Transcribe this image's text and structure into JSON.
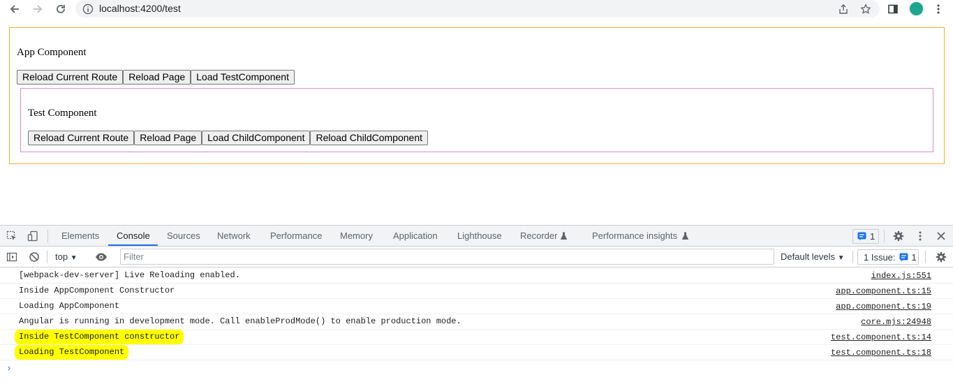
{
  "browser": {
    "url": "localhost:4200/test"
  },
  "app": {
    "heading": "App Component",
    "buttons": [
      "Reload Current Route",
      "Reload Page",
      "Load TestComponent"
    ]
  },
  "test": {
    "heading": "Test Component",
    "buttons": [
      "Reload Current Route",
      "Reload Page",
      "Load ChildComponent",
      "Reload ChildComponent"
    ]
  },
  "devtools": {
    "tabs": [
      "Elements",
      "Console",
      "Sources",
      "Network",
      "Performance",
      "Memory",
      "Application",
      "Lighthouse",
      "Recorder",
      "Performance insights"
    ],
    "active_tab": "Console",
    "issue_count": "1",
    "context": "top",
    "filter_placeholder": "Filter",
    "levels_label": "Default levels",
    "issues_label": "1 Issue:",
    "issues_count": "1"
  },
  "console": {
    "logs": [
      {
        "message": "[webpack-dev-server] Live Reloading enabled.",
        "source": "index.js:551",
        "highlighted": false
      },
      {
        "message": "Inside AppComponent Constructor",
        "source": "app.component.ts:15",
        "highlighted": false
      },
      {
        "message": "Loading AppComponent",
        "source": "app.component.ts:19",
        "highlighted": false
      },
      {
        "message": "Angular is running in development mode. Call enableProdMode() to enable production mode.",
        "source": "core.mjs:24948",
        "highlighted": false
      },
      {
        "message": "Inside TestComponent constructor",
        "source": "test.component.ts:14",
        "highlighted": true
      },
      {
        "message": "Loading TestComponent",
        "source": "test.component.ts:18",
        "highlighted": true
      }
    ],
    "prompt": "›"
  },
  "colors": {
    "app_border": "#f0b030",
    "test_border": "#d58fd6",
    "highlight": "#ffff00",
    "accent": "#1a73e8"
  }
}
